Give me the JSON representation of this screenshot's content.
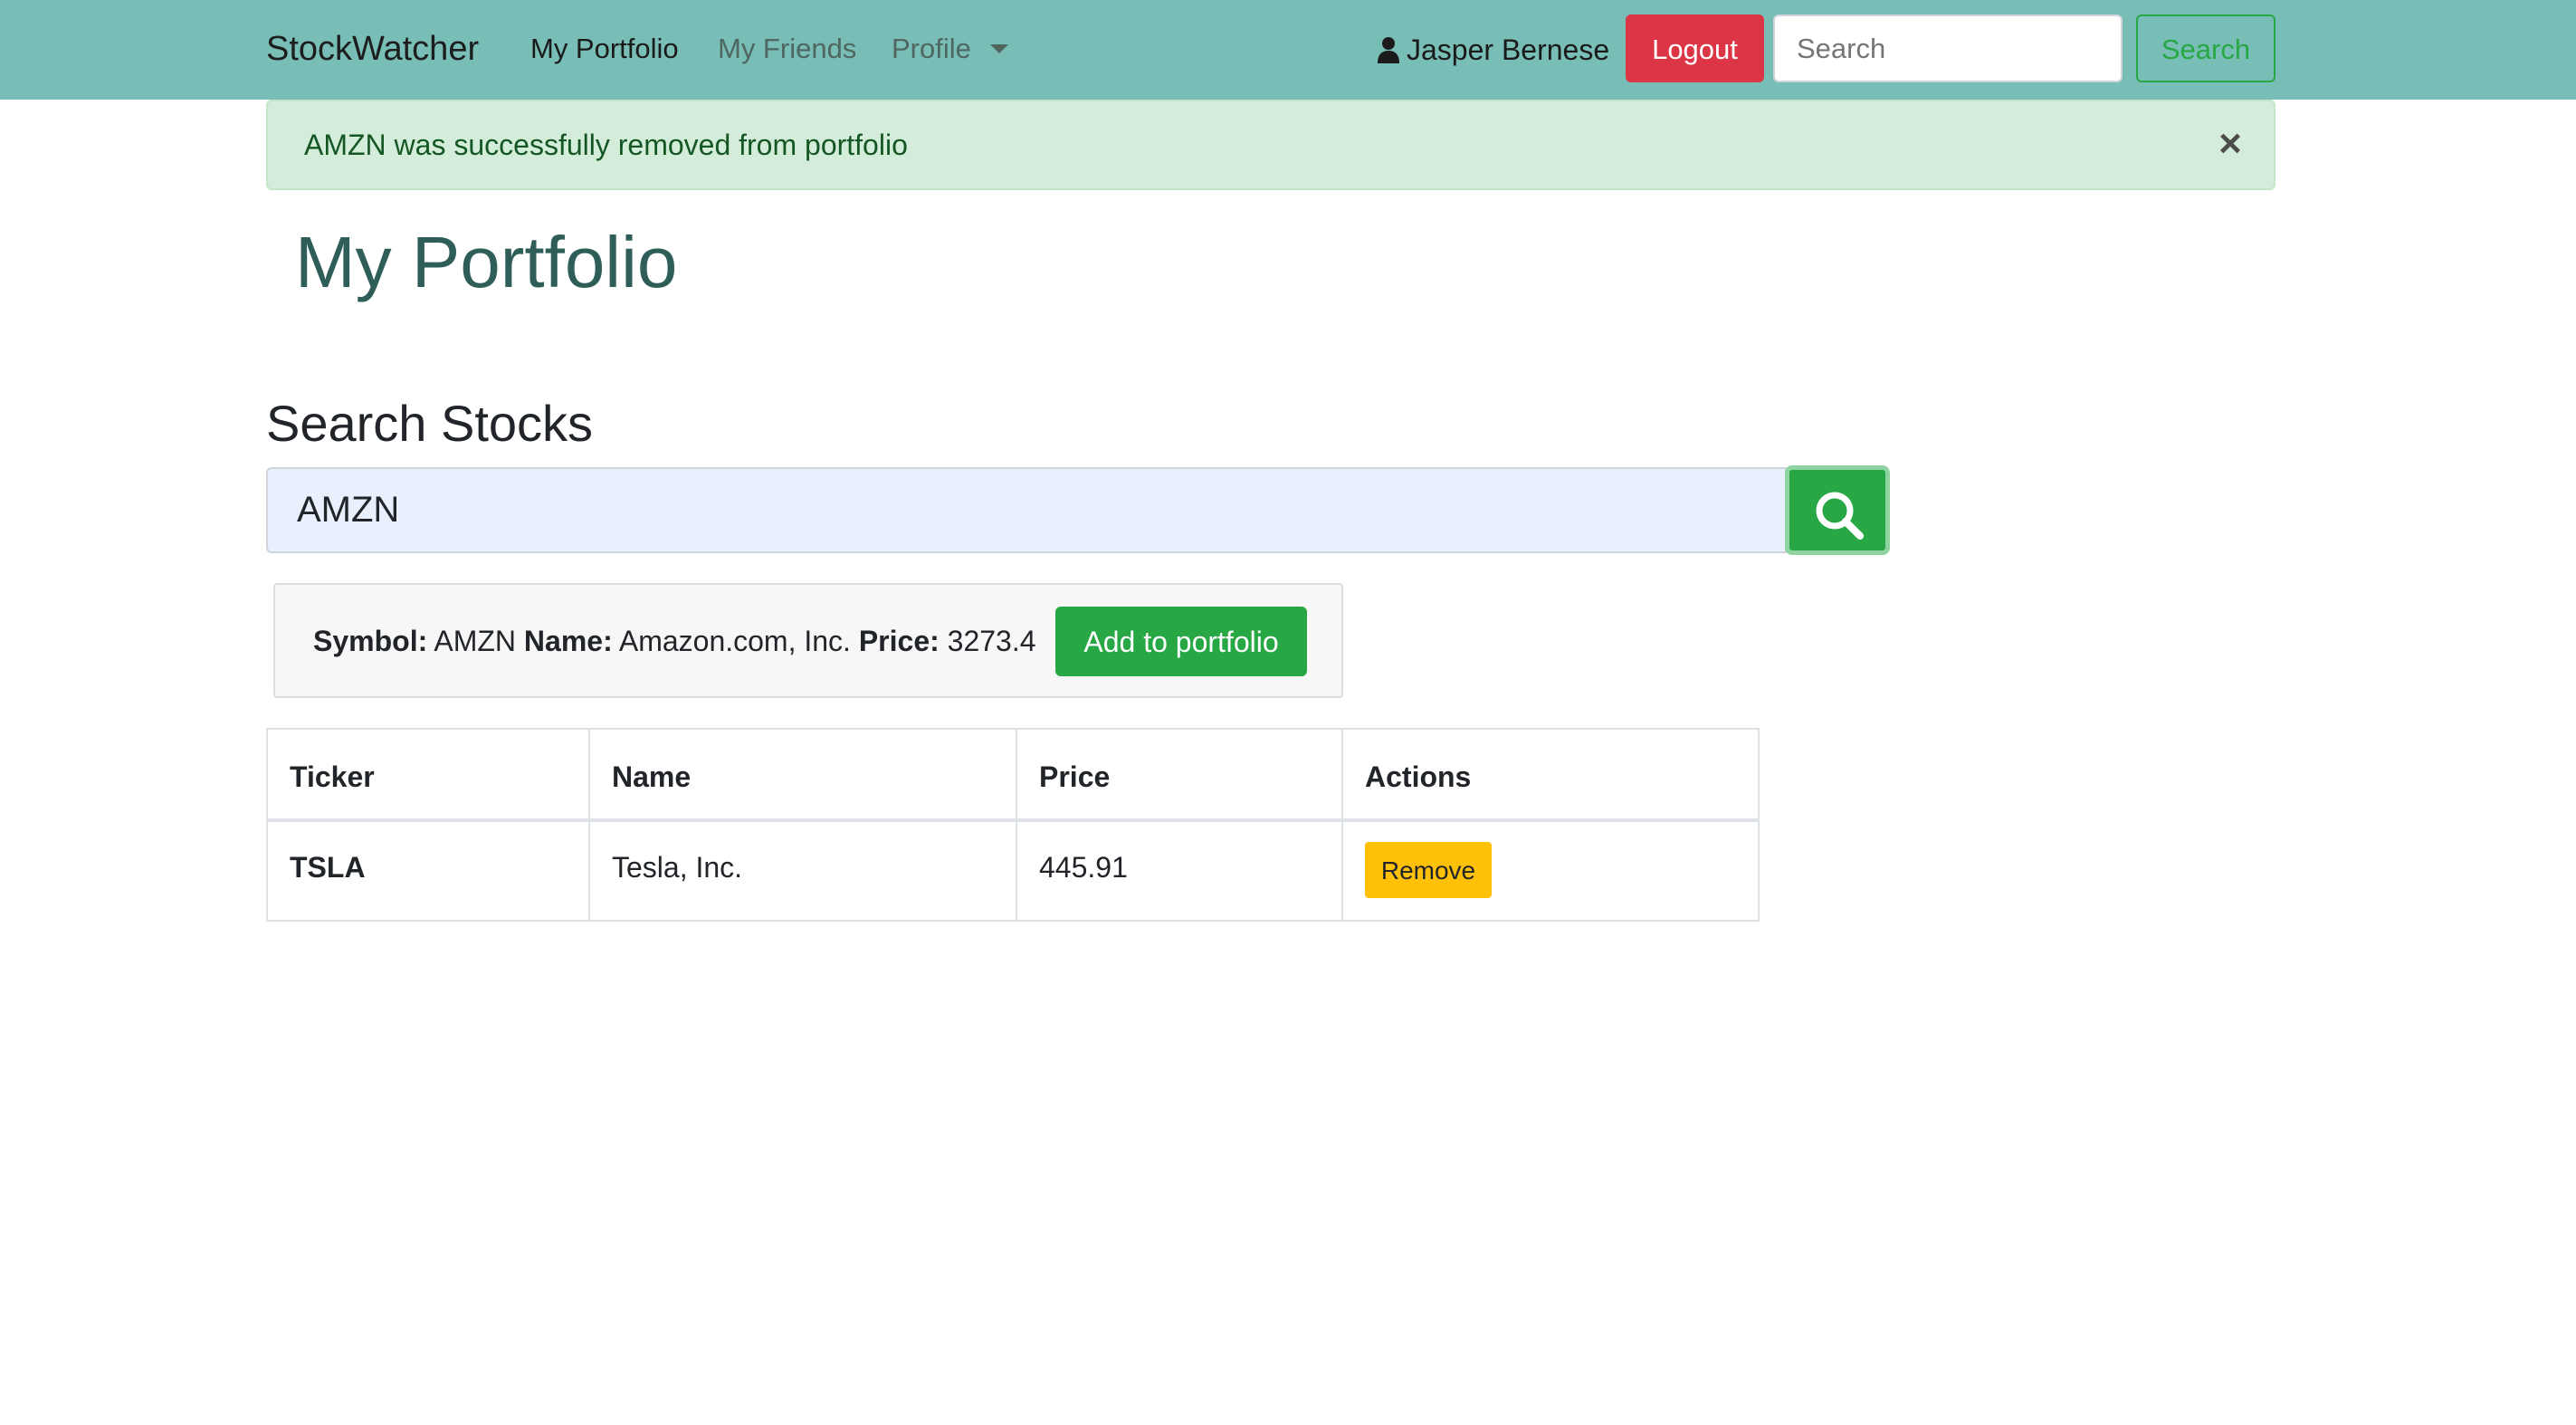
{
  "navbar": {
    "brand": "StockWatcher",
    "links": [
      {
        "label": "My Portfolio",
        "active": true
      },
      {
        "label": "My Friends",
        "active": false
      },
      {
        "label": "Profile",
        "active": false
      }
    ],
    "user_name": "Jasper Bernese",
    "logout_label": "Logout",
    "search_placeholder": "Search",
    "search_button_label": "Search",
    "colors": {
      "background": "#78beb6",
      "logout": "#dc3545",
      "search_outline": "#28a745"
    }
  },
  "alert": {
    "message": "AMZN was successfully removed from portfolio",
    "close_label": "×",
    "type": "success"
  },
  "page_title": "My Portfolio",
  "search_section": {
    "title": "Search Stocks",
    "input_value": "AMZN",
    "button_icon": "search-icon"
  },
  "result": {
    "symbol_label": "Symbol:",
    "symbol": "AMZN",
    "name_label": "Name:",
    "name": "Amazon.com, Inc.",
    "price_label": "Price:",
    "price": "3273.4",
    "add_button_label": "Add to portfolio"
  },
  "table": {
    "headers": [
      "Ticker",
      "Name",
      "Price",
      "Actions"
    ],
    "rows": [
      {
        "ticker": "TSLA",
        "name": "Tesla, Inc.",
        "price": "445.91",
        "action_label": "Remove"
      }
    ]
  }
}
